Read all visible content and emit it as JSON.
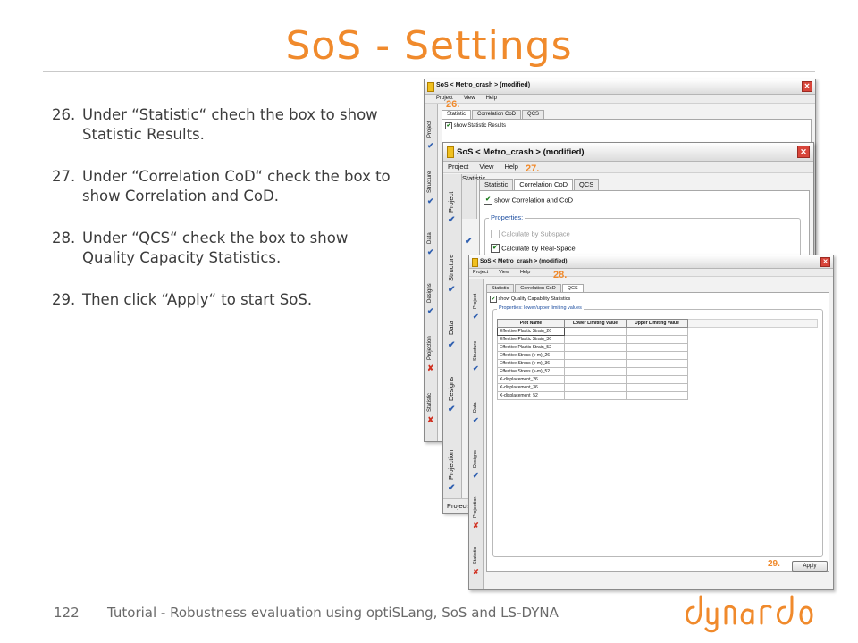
{
  "slide": {
    "title": "SoS - Settings",
    "steps": [
      {
        "num": "26.",
        "text": "Under “Statistic“ chech the box to show Statistic Results."
      },
      {
        "num": "27.",
        "text": "Under “Correlation CoD“ check the box to show Correlation and CoD."
      },
      {
        "num": "28.",
        "text": "Under “QCS“ check the box to show Quality Capacity Statistics."
      },
      {
        "num": "29.",
        "text": "Then click “Apply“ to start SoS."
      }
    ],
    "page_number": "122",
    "footer_text": "Tutorial - Robustness evaluation using optiSLang, SoS and LS-DYNA",
    "logo_text": "dynardo",
    "accent_color": "#f08a2c"
  },
  "windows": {
    "w1": {
      "title": "SoS < Metro_crash > (modified)",
      "menu": [
        "Project",
        "View",
        "Help"
      ],
      "step_tag": "26.",
      "sidebar": [
        {
          "label": "Project",
          "mark": "check"
        },
        {
          "label": "Structure",
          "mark": "check"
        },
        {
          "label": "Data",
          "mark": "check"
        },
        {
          "label": "Designs",
          "mark": "check"
        },
        {
          "label": "Projection",
          "mark": "cross"
        },
        {
          "label": "Statistic",
          "mark": "cross"
        }
      ],
      "tabs": [
        "Statistic",
        "Correlation CoD",
        "QCS"
      ],
      "checkbox_label": "show Statistic Results"
    },
    "w2": {
      "title": "SoS < Metro_crash > (modified)",
      "menu": [
        "Project",
        "View",
        "Help"
      ],
      "step_tag": "27.",
      "sidebar": [
        {
          "label": "Project",
          "mark": "check"
        },
        {
          "label": "Structure",
          "mark": "check"
        },
        {
          "label": "Data",
          "mark": "check"
        },
        {
          "label": "Designs",
          "mark": "check"
        },
        {
          "label": "Projection",
          "mark": "check"
        }
      ],
      "sidebar_right_label": "Statistic",
      "tabs": [
        "Statistic",
        "Correlation CoD",
        "QCS"
      ],
      "checkbox_label": "show Correlation and CoD",
      "properties_legend": "Properties:",
      "option_subspace": "Calculate by Subspace",
      "option_realspace": "Calculate by Real-Space",
      "footer_label": "Project"
    },
    "w3": {
      "title": "SoS < Metro_crash > (modified)",
      "menu": [
        "Project",
        "View",
        "Help"
      ],
      "step_tag": "28.",
      "sidebar": [
        {
          "label": "Project",
          "mark": "check"
        },
        {
          "label": "Structure",
          "mark": "check"
        },
        {
          "label": "Data",
          "mark": "check"
        },
        {
          "label": "Designs",
          "mark": "check"
        },
        {
          "label": "Projection",
          "mark": "cross"
        },
        {
          "label": "Statistic",
          "mark": "cross"
        }
      ],
      "tabs": [
        "Statistic",
        "Correlation CoD",
        "QCS"
      ],
      "checkbox_label": "show Quality Capability Statistics",
      "properties_legend": "Properties: lower/upper limiting values",
      "table": {
        "headers": [
          "Plot Name",
          "Lower Limiting Value",
          "Upper Limiting Value"
        ],
        "rows": [
          "Effective Plastic Strain_26",
          "Effective Plastic Strain_36",
          "Effective Plastic Strain_52",
          "Effective Stress (v-m)_26",
          "Effective Stress (v-m)_36",
          "Effective Stress (v-m)_52",
          "X-displacement_26",
          "X-displacement_36",
          "X-displacement_52"
        ]
      },
      "apply_step_tag": "29.",
      "apply_label": "Apply"
    }
  }
}
